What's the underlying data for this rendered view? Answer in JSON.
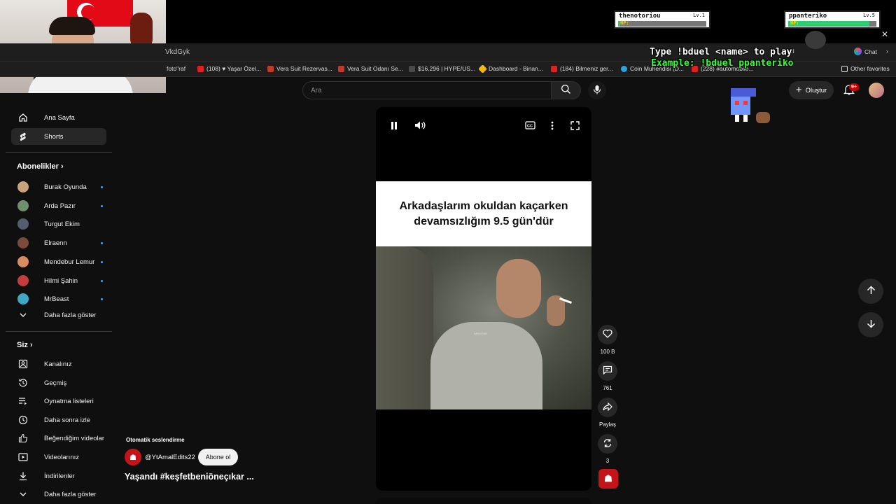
{
  "browser": {
    "url_fragment": "VkdGyk",
    "bookmarks": [
      {
        "label": "foto\"raf",
        "color": "#888888"
      },
      {
        "label": "(108) ♥ Yaşar Özel...",
        "color": "#e02020"
      },
      {
        "label": "Vera Suit Rezervas...",
        "color": "#c0392b"
      },
      {
        "label": "Vera Suit Odanı Se...",
        "color": "#c0392b"
      },
      {
        "label": "$16,296 | HYPE/US...",
        "color": "#4a4a4a"
      },
      {
        "label": "Dashboard - Binan...",
        "color": "#f0b90b"
      },
      {
        "label": "(184) Bilmeniz ger...",
        "color": "#e02020"
      },
      {
        "label": "Coin Muhendisi (D...",
        "color": "#2aa3e0"
      },
      {
        "label": "(228) #automobile...",
        "color": "#e02020"
      }
    ],
    "other_favorites": "Other favorites",
    "chat": "Chat",
    "verify": "Veri"
  },
  "stream_overlay": {
    "player1": {
      "name": "thenotoriou",
      "level": "Lv.1",
      "hp_label": "HP:",
      "hp_fraction": 0.02
    },
    "player2": {
      "name": "ppanteriko",
      "level": "Lv.5",
      "hp_label": "HP:",
      "hp_fraction": 0.92
    },
    "duel_instruction": "Type !bduel <name> to play",
    "duel_example": "Example: !bduel ppanteriko"
  },
  "header": {
    "search_placeholder": "Ara",
    "create_label": "Oluştur",
    "notifications_badge": "9+"
  },
  "sidebar": {
    "main": [
      {
        "label": "Ana Sayfa",
        "icon": "home-icon"
      },
      {
        "label": "Shorts",
        "icon": "shorts-icon",
        "active": true
      }
    ],
    "subscriptions_title": "Abonelikler",
    "subscriptions": [
      {
        "label": "Burak Oyunda",
        "avatar_color": "#c9a27a"
      },
      {
        "label": "Arda Pazır",
        "avatar_color": "#6f8f6f"
      },
      {
        "label": "Turgut Ekim",
        "avatar_color": "#555c6e"
      },
      {
        "label": "Elraenn",
        "avatar_color": "#7a4b3a"
      },
      {
        "label": "Mendebur Lemur",
        "avatar_color": "#d98c5f"
      },
      {
        "label": "Hilmi Şahin",
        "avatar_color": "#c43d3d"
      },
      {
        "label": "MrBeast",
        "avatar_color": "#3fa7c6"
      }
    ],
    "subscriptions_more": "Daha fazla göster",
    "you_title": "Siz",
    "you_items": [
      {
        "label": "Kanalınız",
        "icon": "channel-icon"
      },
      {
        "label": "Geçmiş",
        "icon": "history-icon"
      },
      {
        "label": "Oynatma listeleri",
        "icon": "playlists-icon"
      },
      {
        "label": "Daha sonra izle",
        "icon": "watch-later-icon"
      },
      {
        "label": "Beğendiğim videolar",
        "icon": "like-icon"
      },
      {
        "label": "Videolarınız",
        "icon": "videos-icon"
      },
      {
        "label": "İndirilenler",
        "icon": "download-icon"
      }
    ],
    "you_more": "Daha fazla göster"
  },
  "short": {
    "caption": "Arkadaşlarım okuldan kaçarken devamsızlığım 9.5 gün'dür",
    "watermark": "ARKOTAR",
    "auto_dub": "Otomatik seslendirme",
    "channel": "@YtAmalEdits22",
    "subscribe": "Abone ol",
    "title": "Yaşandı #keşfetbeniöneçıkar ...",
    "likes": "100 B",
    "comments": "761",
    "share": "Paylaş",
    "remix": "3"
  },
  "colors": {
    "accent_red": "#cc0000",
    "link_blue": "#3ea6ff",
    "hp_green": "#2ecc71"
  }
}
